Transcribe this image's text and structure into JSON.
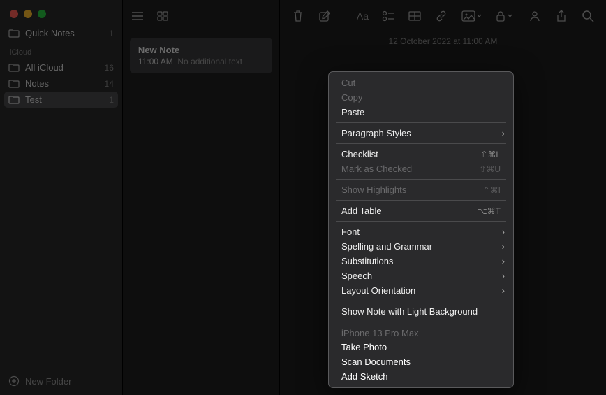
{
  "sidebar": {
    "quick_notes_label": "Quick Notes",
    "quick_notes_count": "1",
    "section_header": "iCloud",
    "items": [
      {
        "label": "All iCloud",
        "count": "16"
      },
      {
        "label": "Notes",
        "count": "14"
      },
      {
        "label": "Test",
        "count": "1"
      }
    ],
    "new_folder_label": "New Folder"
  },
  "notelist": {
    "card": {
      "title": "New Note",
      "time": "11:00 AM",
      "preview": "No additional text"
    }
  },
  "editor": {
    "date_line": "12 October 2022 at 11:00 AM",
    "format_label": "Aa"
  },
  "context_menu": {
    "cut": "Cut",
    "copy": "Copy",
    "paste": "Paste",
    "paragraph_styles": "Paragraph Styles",
    "checklist": "Checklist",
    "checklist_shortcut": "⇧⌘L",
    "mark_checked": "Mark as Checked",
    "mark_checked_shortcut": "⇧⌘U",
    "show_highlights": "Show Highlights",
    "show_highlights_shortcut": "⌃⌘I",
    "add_table": "Add Table",
    "add_table_shortcut": "⌥⌘T",
    "font": "Font",
    "spelling": "Spelling and Grammar",
    "substitutions": "Substitutions",
    "speech": "Speech",
    "layout": "Layout Orientation",
    "light_bg": "Show Note with Light Background",
    "device_header": "iPhone 13 Pro Max",
    "take_photo": "Take Photo",
    "scan_docs": "Scan Documents",
    "add_sketch": "Add Sketch"
  }
}
